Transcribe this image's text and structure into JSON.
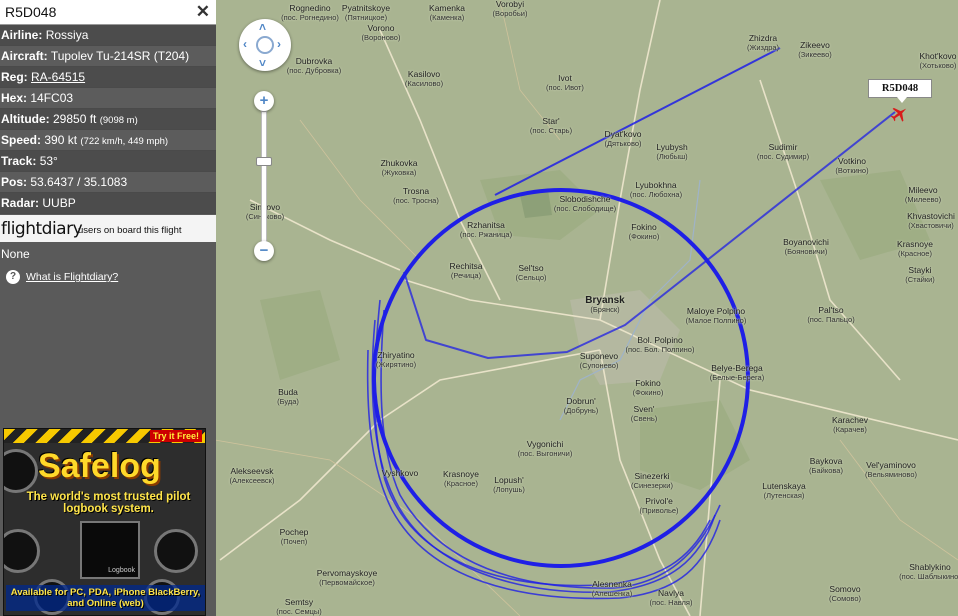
{
  "panel": {
    "title": "R5D048",
    "close_icon": "close-icon",
    "rows": [
      {
        "label": "Airline:",
        "value": "Rossiya"
      },
      {
        "label": "Aircraft:",
        "value": "Tupolev Tu-214SR (T204)"
      },
      {
        "label": "Reg:",
        "value": "RA-64515"
      },
      {
        "label": "Hex:",
        "value": "14FC03"
      },
      {
        "label": "Altitude:",
        "value": "29850 ft",
        "extra": "(9098 m)"
      },
      {
        "label": "Speed:",
        "value": "390 kt",
        "extra": "(722 km/h, 449 mph)"
      },
      {
        "label": "Track:",
        "value": "53°"
      },
      {
        "label": "Pos:",
        "value": "53.6437 / 35.1083"
      },
      {
        "label": "Radar:",
        "value": "UUBP"
      }
    ],
    "flightdiary": {
      "logo": "flightdiary",
      "tagline": "users on board this flight",
      "users": "None",
      "help_link": "What is Flightdiary?"
    },
    "ad": {
      "try": "Try it Free!",
      "brand": "Safelog",
      "slogan": "The world's most trusted pilot logbook system.",
      "book_label": "Logbook",
      "availability": "Available for PC, PDA, iPhone BlackBerry, and Online (web)"
    }
  },
  "map": {
    "flight_label": "R5D048",
    "track_color": "#1f1fe6",
    "map_color": "#a9b491",
    "towns": [
      {
        "name": "Rognedino",
        "ru": "(пос. Рогнедино)"
      },
      {
        "name": "Pyatnitskoye",
        "ru": "(Пятницкое)"
      },
      {
        "name": "Kamenka",
        "ru": "(Каменка)"
      },
      {
        "name": "Vorobyi",
        "ru": "(Воробьи)"
      },
      {
        "name": "Zhizdra",
        "ru": "(Жиздра)"
      },
      {
        "name": "Zikeevo",
        "ru": "(Зикеево)"
      },
      {
        "name": "Khot'kovo",
        "ru": "(Хотьково)"
      },
      {
        "name": "Vorono",
        "ru": "(Вороново)"
      },
      {
        "name": "Dubrovka",
        "ru": "(пос. Дубровка)"
      },
      {
        "name": "Kasilovo",
        "ru": "(Касилово)"
      },
      {
        "name": "Ivot",
        "ru": "(пос. Ивот)"
      },
      {
        "name": "Star'",
        "ru": "(пос. Старь)"
      },
      {
        "name": "Dyat'kovo",
        "ru": "(Дятьково)"
      },
      {
        "name": "Lyubysh",
        "ru": "(Любыш)"
      },
      {
        "name": "Sudimir",
        "ru": "(пос. Судимир)"
      },
      {
        "name": "Votkino",
        "ru": "(Воткино)"
      },
      {
        "name": "Zhukovka",
        "ru": "(Жуковка)"
      },
      {
        "name": "Trosna",
        "ru": "(пос. Тросна)"
      },
      {
        "name": "Sinkovo",
        "ru": "(Синьково)"
      },
      {
        "name": "Lyubokhna",
        "ru": "(пос. Любохна)"
      },
      {
        "name": "Slobodishche",
        "ru": "(пос. Слободище)"
      },
      {
        "name": "Mileevo",
        "ru": "(Милеево)"
      },
      {
        "name": "Khvastovichi",
        "ru": "(Хвастовичи)"
      },
      {
        "name": "Rzhanitsa",
        "ru": "(пос. Ржаница)"
      },
      {
        "name": "Fokino",
        "ru": "(Фокино)"
      },
      {
        "name": "Boyanovichi",
        "ru": "(Бояновичи)"
      },
      {
        "name": "Krasnoye",
        "ru": "(Красное)"
      },
      {
        "name": "Stayki",
        "ru": "(Стайки)"
      },
      {
        "name": "Rechitsa",
        "ru": "(Речица)"
      },
      {
        "name": "Sel'tso",
        "ru": "(Сельцо)"
      },
      {
        "name": "Bryansk",
        "ru": "(Брянск)"
      },
      {
        "name": "Maloye Polpino",
        "ru": "(Малое Полпино)"
      },
      {
        "name": "Pal'tso",
        "ru": "(пос. Пальцо)"
      },
      {
        "name": "Zhiryatino",
        "ru": "(Жирятино)"
      },
      {
        "name": "Bol. Polpino",
        "ru": "(пос. Бол. Полпино)"
      },
      {
        "name": "Suponevo",
        "ru": "(Супонево)"
      },
      {
        "name": "Belye-Berega",
        "ru": "(Белые-Берега)"
      },
      {
        "name": "Buda",
        "ru": "(Буда)"
      },
      {
        "name": "Fokino",
        "ru": "(Фокино)"
      },
      {
        "name": "Dobrun'",
        "ru": "(Добрунь)"
      },
      {
        "name": "Sven'",
        "ru": "(Свень)"
      },
      {
        "name": "Karachev",
        "ru": "(Карачев)"
      },
      {
        "name": "Vygonichi",
        "ru": "(пос. Выгоничи)"
      },
      {
        "name": "Alekseevsk",
        "ru": "(Алексеевск)"
      },
      {
        "name": "Krasnoye",
        "ru": "(Красное)"
      },
      {
        "name": "Lopush'",
        "ru": "(Лопушь)"
      },
      {
        "name": "Sinezerki",
        "ru": "(Синезерки)"
      },
      {
        "name": "Baykova",
        "ru": "(Байкова)"
      },
      {
        "name": "Vel'yaminovo",
        "ru": "(Вельяминово)"
      },
      {
        "name": "Privol'e",
        "ru": "(Приволье)"
      },
      {
        "name": "Lutenskaya",
        "ru": "(Лутенская)"
      },
      {
        "name": "Pochep",
        "ru": "(Почеп)"
      },
      {
        "name": "Pervomayskoye",
        "ru": "(Первомайское)"
      },
      {
        "name": "Alesnenka",
        "ru": "(Алешенка)"
      },
      {
        "name": "Navlya",
        "ru": "(пос. Навля)"
      },
      {
        "name": "Somovo",
        "ru": "(Сомово)"
      },
      {
        "name": "Shablykino",
        "ru": "(пос. Шаблыкино)"
      },
      {
        "name": "Semtsy",
        "ru": "(пос. Семцы)"
      },
      {
        "name": "Vyshkovo",
        "ru": ""
      }
    ]
  }
}
